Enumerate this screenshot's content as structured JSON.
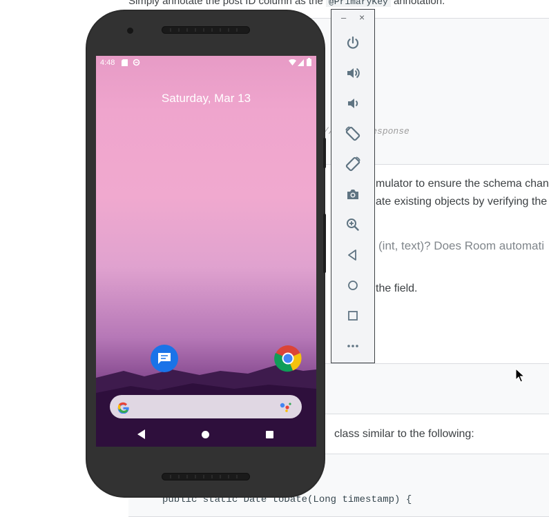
{
  "doc": {
    "intro_prefix": "Simply annotate the post ID column as the",
    "intro_code": "@PrimaryKey",
    "intro_suffix": "annotation.",
    "code_comment": "// json response",
    "para1_line1": "mulator to ensure the schema chan",
    "para1_line2": "ate existing objects by verifying the",
    "question": "(int, text)? Does Room automati",
    "field_text": "the field.",
    "class_text": "class similar to the following:",
    "code_line": "public static Date toDate(Long timestamp) {"
  },
  "toolbar": {
    "minimize": "–",
    "close": "×",
    "buttons": [
      "power-icon",
      "volume-up-icon",
      "volume-down-icon",
      "rotate-left-icon",
      "rotate-right-icon",
      "camera-icon",
      "zoom-icon",
      "back-icon",
      "home-icon",
      "overview-icon",
      "more-icon"
    ]
  },
  "phone": {
    "time": "4:48",
    "date": "Saturday, Mar 13",
    "apps": [
      "messages-icon",
      "chrome-icon"
    ]
  },
  "colors": {
    "accent": "#1a73e8",
    "toolbar_icon": "#5f7482"
  }
}
